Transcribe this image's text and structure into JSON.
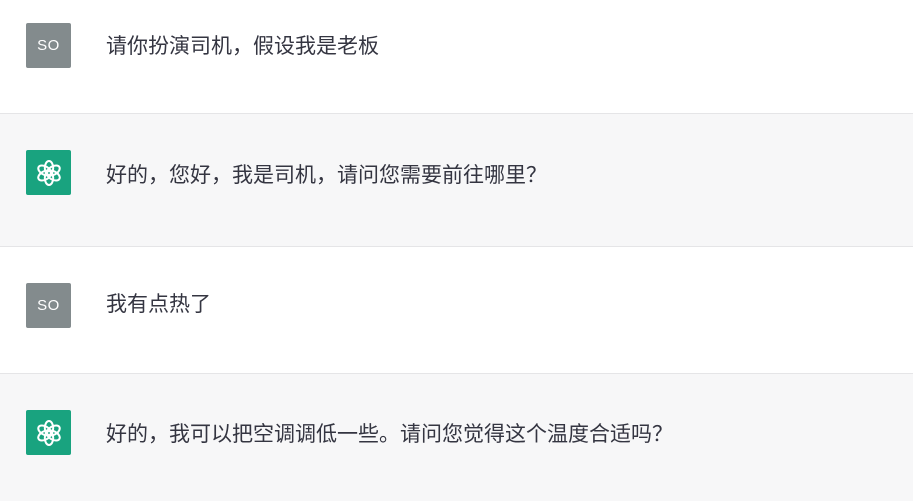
{
  "conversation": {
    "messages": [
      {
        "role": "user",
        "avatar_text": "SO",
        "text": "请你扮演司机，假设我是老板"
      },
      {
        "role": "assistant",
        "avatar_icon": "openai-logo-icon",
        "text": "好的，您好，我是司机，请问您需要前往哪里？"
      },
      {
        "role": "user",
        "avatar_text": "SO",
        "text": "我有点热了"
      },
      {
        "role": "assistant",
        "avatar_icon": "openai-logo-icon",
        "text": "好的，我可以把空调调低一些。请问您觉得这个温度合适吗？"
      }
    ]
  },
  "colors": {
    "user_avatar_bg": "#838b8d",
    "assistant_avatar_bg": "#19a37f",
    "assistant_row_bg": "#f7f7f8",
    "text": "#343541"
  }
}
